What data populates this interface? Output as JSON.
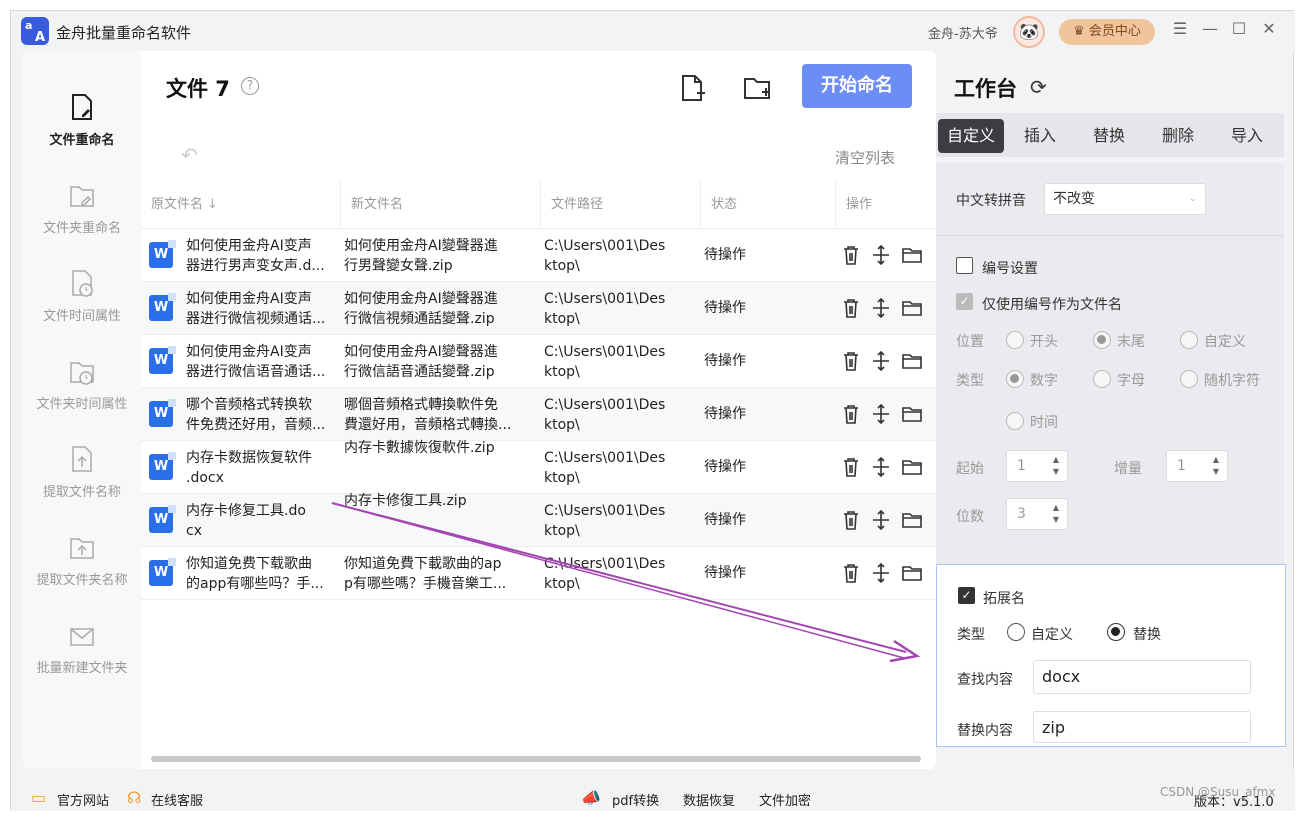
{
  "app": {
    "title": "金舟批量重命名软件",
    "logo_top": "a",
    "logo_bottom": "A",
    "user_name": "金舟-苏大爷",
    "vip_label": "会员中心",
    "colors": {
      "accent": "#6c8cf6",
      "vip": "#f1c49b",
      "active_tab": "#3b3d42",
      "arrow": "#a246b0"
    }
  },
  "sidebar": {
    "items": [
      {
        "label": "文件重命名",
        "icon": "file-edit-icon"
      },
      {
        "label": "文件夹重命名",
        "icon": "folder-edit-icon"
      },
      {
        "label": "文件时间属性",
        "icon": "file-clock-icon"
      },
      {
        "label": "文件夹时间属性",
        "icon": "folder-clock-icon"
      },
      {
        "label": "提取文件名称",
        "icon": "file-upload-icon"
      },
      {
        "label": "提取文件夹名称",
        "icon": "folder-upload-icon"
      },
      {
        "label": "批量新建文件夹",
        "icon": "mail-folder-icon"
      }
    ]
  },
  "main": {
    "title": "文件 7",
    "help": "?",
    "start_label": "开始命名",
    "clear_label": "清空列表",
    "columns": [
      "原文件名",
      "新文件名",
      "文件路径",
      "状态",
      "操作"
    ],
    "sort_arrow": "↓",
    "rows": [
      {
        "orig": [
          "如何使用金舟AI变声",
          "器进行男声变女声.d..."
        ],
        "new": [
          "如何使用金舟AI變聲器進",
          "行男聲變女聲.zip"
        ],
        "path": [
          "C:\\Users\\001\\Des",
          "ktop\\"
        ],
        "status": "待操作"
      },
      {
        "orig": [
          "如何使用金舟AI变声",
          "器进行微信视频通话..."
        ],
        "new": [
          "如何使用金舟AI變聲器進",
          "行微信視頻通話變聲.zip"
        ],
        "path": [
          "C:\\Users\\001\\Des",
          "ktop\\"
        ],
        "status": "待操作"
      },
      {
        "orig": [
          "如何使用金舟AI变声",
          "器进行微信语音通话..."
        ],
        "new": [
          "如何使用金舟AI變聲器進",
          "行微信語音通話變聲.zip"
        ],
        "path": [
          "C:\\Users\\001\\Des",
          "ktop\\"
        ],
        "status": "待操作"
      },
      {
        "orig": [
          "哪个音频格式转换软",
          "件免费还好用，音频..."
        ],
        "new": [
          "哪個音頻格式轉換軟件免",
          "費還好用，音頻格式轉換..."
        ],
        "path": [
          "C:\\Users\\001\\Des",
          "ktop\\"
        ],
        "status": "待操作"
      },
      {
        "orig": [
          "内存卡数据恢复软件",
          ".docx"
        ],
        "new": [
          "",
          "内存卡數據恢復軟件.zip"
        ],
        "path": [
          "C:\\Users\\001\\Des",
          "ktop\\"
        ],
        "status": "待操作"
      },
      {
        "orig": [
          "内存卡修复工具.do",
          "cx"
        ],
        "new": [
          "",
          "内存卡修復工具.zip"
        ],
        "path": [
          "C:\\Users\\001\\Des",
          "ktop\\"
        ],
        "status": "待操作"
      },
      {
        "orig": [
          "你知道免费下载歌曲",
          "的app有哪些吗？手..."
        ],
        "new": [
          "你知道免費下載歌曲的ap",
          "p有哪些嗎？手機音樂工..."
        ],
        "path": [
          "C:\\Users\\001\\Des",
          "ktop\\"
        ],
        "status": "待操作"
      }
    ]
  },
  "workspace": {
    "title": "工作台",
    "tabs": [
      "自定义",
      "插入",
      "替换",
      "删除",
      "导入"
    ],
    "active_tab": "自定义",
    "pinyin_label": "中文转拼音",
    "pinyin_value": "不改变",
    "numbering_label": "编号设置",
    "only_number_label": "仅使用编号作为文件名",
    "position_label": "位置",
    "position_options": [
      "开头",
      "末尾",
      "自定义"
    ],
    "position_selected": "末尾",
    "type_label": "类型",
    "type_options": [
      "数字",
      "字母",
      "随机字符",
      "时间"
    ],
    "type_selected": "数字",
    "start_label": "起始",
    "start_value": "1",
    "increment_label": "增量",
    "increment_value": "1",
    "digits_label": "位数",
    "digits_value": "3",
    "extension": {
      "label": "拓展名",
      "checked": true,
      "type_label": "类型",
      "type_options": [
        "自定义",
        "替换"
      ],
      "type_selected": "替换",
      "find_label": "查找内容",
      "find_value": "docx",
      "replace_label": "替换内容",
      "replace_value": "zip"
    }
  },
  "footer": {
    "website": "官方网站",
    "service": "在线客服",
    "pdf": "pdf转换",
    "recovery": "数据恢复",
    "encrypt": "文件加密",
    "version": "版本：v5.1.0",
    "watermark": "CSDN @Susu_afmx"
  }
}
